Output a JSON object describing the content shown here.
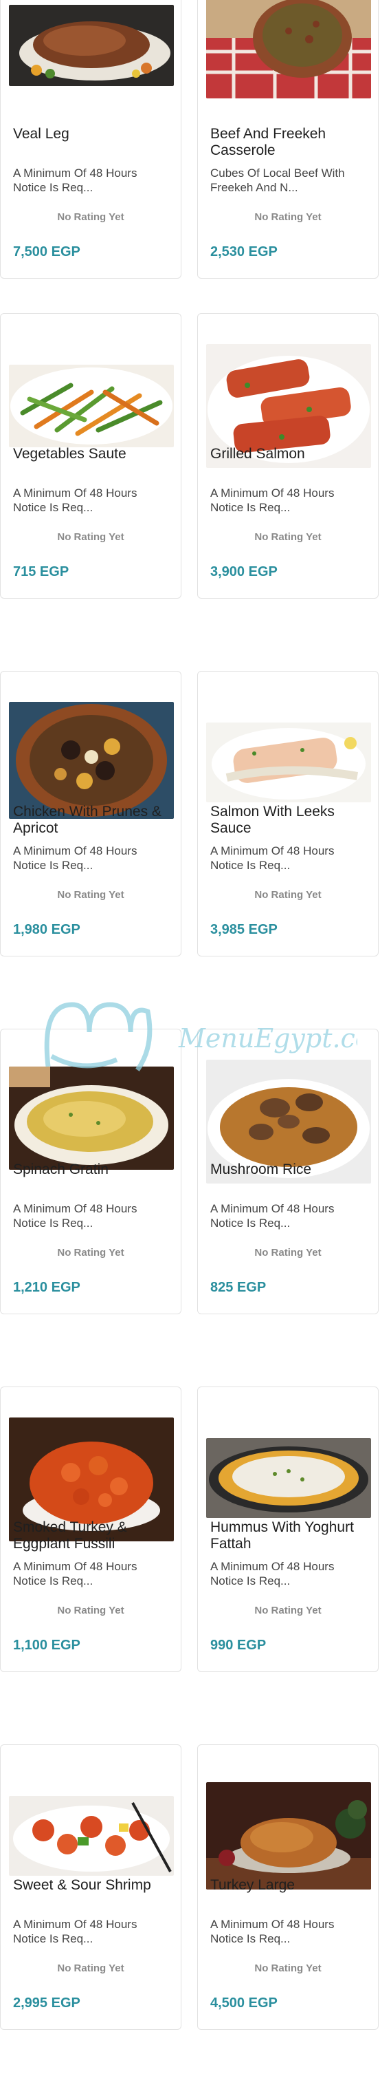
{
  "watermark": {
    "text": "MenuEgypt.com"
  },
  "items": [
    {
      "title": "Veal Leg",
      "description": "A Minimum Of 48 Hours Notice Is Req...",
      "rating": "No Rating Yet",
      "price": "7,500 EGP",
      "image_icon": "roast-meat-image"
    },
    {
      "title": "Beef And Freekeh Casserole",
      "description": "Cubes Of Local Beef With Freekeh And N...",
      "rating": "No Rating Yet",
      "price": "2,530 EGP",
      "image_icon": "casserole-image"
    },
    {
      "title": "Vegetables Saute",
      "description": "A Minimum Of 48 Hours Notice Is Req...",
      "rating": "No Rating Yet",
      "price": "715 EGP",
      "image_icon": "vegetables-image"
    },
    {
      "title": "Grilled Salmon",
      "description": "A Minimum Of 48 Hours Notice Is Req...",
      "rating": "No Rating Yet",
      "price": "3,900 EGP",
      "image_icon": "salmon-image"
    },
    {
      "title": "Chicken With Prunes & Apricot",
      "description": "A Minimum Of 48 Hours Notice Is Req...",
      "rating": "No Rating Yet",
      "price": "1,980 EGP",
      "image_icon": "tagine-image"
    },
    {
      "title": "Salmon With Leeks Sauce",
      "description": "A Minimum Of 48 Hours Notice Is Req...",
      "rating": "No Rating Yet",
      "price": "3,985 EGP",
      "image_icon": "salmon-sauce-image"
    },
    {
      "title": "Spinach Gratin",
      "description": "A Minimum Of 48 Hours Notice Is Req...",
      "rating": "No Rating Yet",
      "price": "1,210 EGP",
      "image_icon": "gratin-image"
    },
    {
      "title": "Mushroom Rice",
      "description": "A Minimum Of 48 Hours Notice Is Req...",
      "rating": "No Rating Yet",
      "price": "825 EGP",
      "image_icon": "mushroom-rice-image"
    },
    {
      "title": "Smoked Turkey & Eggplant Fussili",
      "description": "A Minimum Of 48 Hours Notice Is Req...",
      "rating": "No Rating Yet",
      "price": "1,100 EGP",
      "image_icon": "pasta-image"
    },
    {
      "title": "Hummus With Yoghurt Fattah",
      "description": "A Minimum Of 48 Hours Notice Is Req...",
      "rating": "No Rating Yet",
      "price": "990 EGP",
      "image_icon": "fattah-image"
    },
    {
      "title": "Sweet & Sour Shrimp",
      "description": "A Minimum Of 48 Hours Notice Is Req...",
      "rating": "No Rating Yet",
      "price": "2,995 EGP",
      "image_icon": "shrimp-image"
    },
    {
      "title": "Turkey Large",
      "description": "A Minimum Of 48 Hours Notice Is Req...",
      "rating": "No Rating Yet",
      "price": "4,500 EGP",
      "image_icon": "roast-turkey-image"
    }
  ],
  "colors": {
    "price": "#2a8f9e",
    "rating": "#8a8a8a",
    "card_border": "#e2e2e2"
  }
}
